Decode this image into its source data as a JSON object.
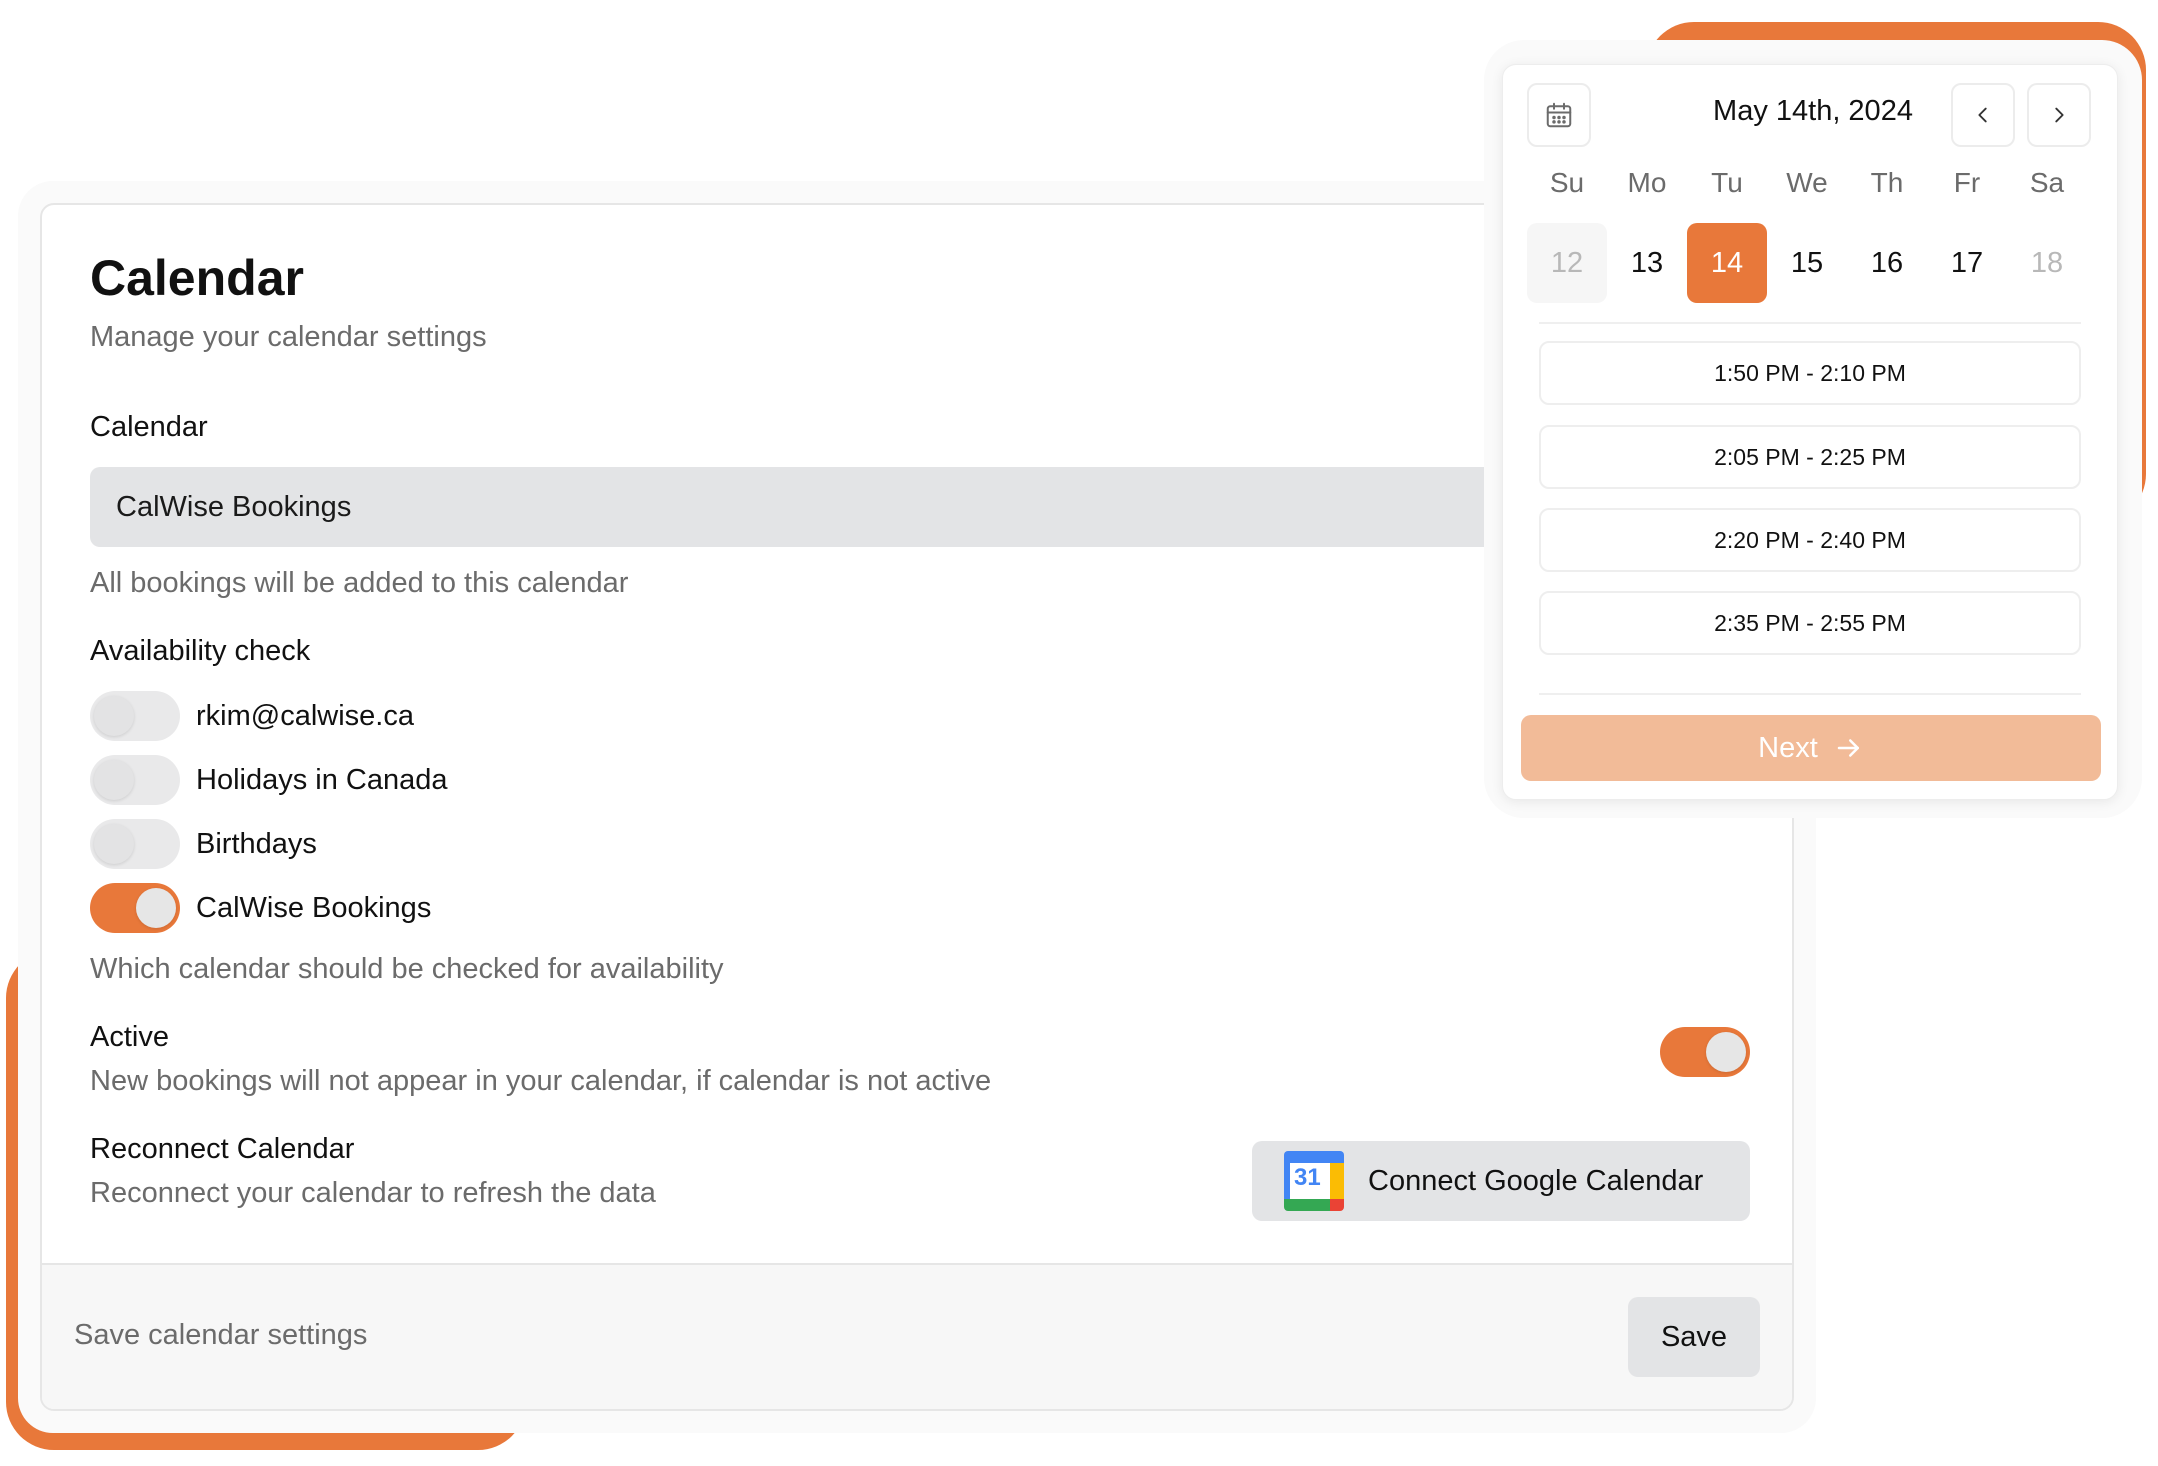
{
  "settings": {
    "title": "Calendar",
    "subtitle": "Manage your calendar settings",
    "calendar_label": "Calendar",
    "calendar_value": "CalWise Bookings",
    "calendar_helper": "All bookings will be added to this calendar",
    "availability_label": "Availability check",
    "availability_items": [
      {
        "label": "rkim@calwise.ca",
        "checked": false
      },
      {
        "label": "Holidays in Canada",
        "checked": false
      },
      {
        "label": "Birthdays",
        "checked": false
      },
      {
        "label": "CalWise Bookings",
        "checked": true
      }
    ],
    "availability_helper": "Which calendar should be checked for availability",
    "active_label": "Active",
    "active_helper": "New bookings will not appear in your calendar, if calendar is not active",
    "active_on": true,
    "reconnect_label": "Reconnect Calendar",
    "reconnect_helper": "Reconnect your calendar to refresh the data",
    "connect_button": "Connect Google Calendar",
    "connect_icon_number": "31",
    "footer_text": "Save calendar settings",
    "save_button": "Save"
  },
  "picker": {
    "title": "May 14th, 2024",
    "weekdays": [
      "Su",
      "Mo",
      "Tu",
      "We",
      "Th",
      "Fr",
      "Sa"
    ],
    "days": [
      "12",
      "13",
      "14",
      "15",
      "16",
      "17",
      "18"
    ],
    "selected_day": "14",
    "slots": [
      "1:50 PM - 2:10 PM",
      "2:05 PM - 2:25 PM",
      "2:20 PM - 2:40 PM",
      "2:35 PM - 2:55 PM"
    ],
    "next_button": "Next"
  },
  "colors": {
    "accent": "#e8783a",
    "accent_light": "#f2bb98",
    "muted_text": "#6b6b6b",
    "button_bg": "#e3e4e6"
  },
  "icons": {
    "picker_icon": "calendar-icon",
    "prev": "chevron-left-icon",
    "next": "chevron-right-icon",
    "next_button_icon": "arrow-right-icon",
    "connect_icon": "google-calendar-icon"
  }
}
